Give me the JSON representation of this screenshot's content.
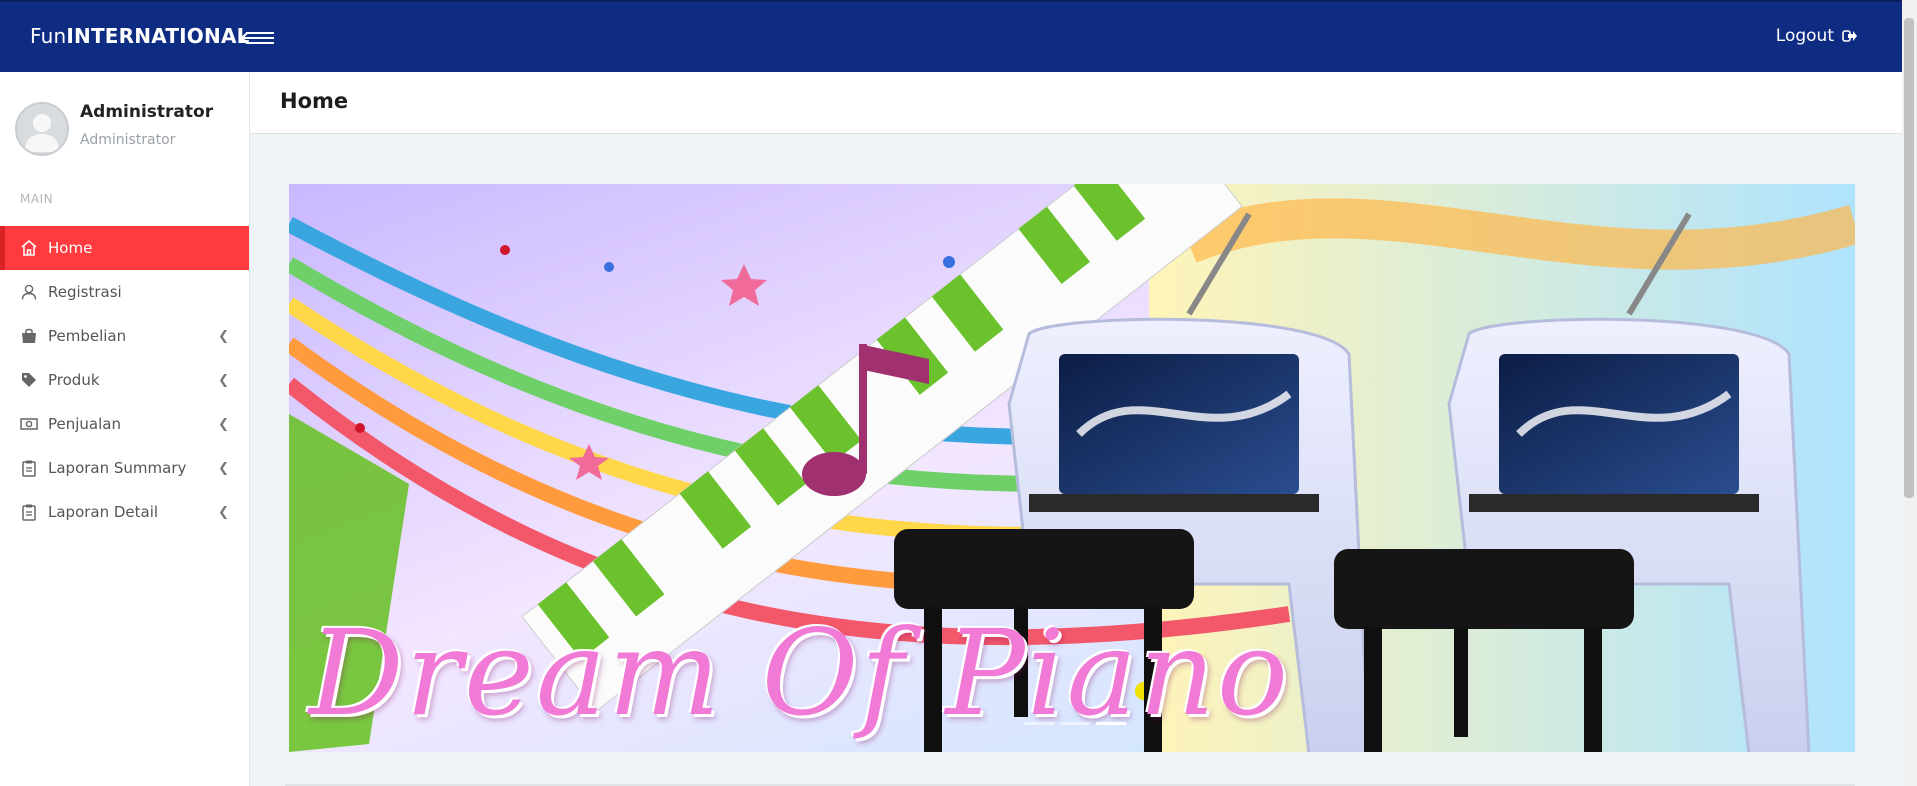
{
  "brand": {
    "part1": "Fun",
    "part2": "INTERNATIONAL"
  },
  "topbar": {
    "logout_label": "Logout",
    "menu_icon": "hamburger-arrow-icon",
    "logout_icon": "sign-out-icon"
  },
  "user": {
    "name": "Administrator",
    "role": "Administrator"
  },
  "sidebar": {
    "section_label": "MAIN",
    "items": [
      {
        "label": "Home",
        "icon": "home-icon",
        "active": true,
        "has_submenu": false
      },
      {
        "label": "Registrasi",
        "icon": "user-icon",
        "active": false,
        "has_submenu": false
      },
      {
        "label": "Pembelian",
        "icon": "shopping-bag-icon",
        "active": false,
        "has_submenu": true
      },
      {
        "label": "Produk",
        "icon": "tag-icon",
        "active": false,
        "has_submenu": true
      },
      {
        "label": "Penjualan",
        "icon": "money-icon",
        "active": false,
        "has_submenu": true
      },
      {
        "label": "Laporan Summary",
        "icon": "clipboard-icon",
        "active": false,
        "has_submenu": true
      },
      {
        "label": "Laporan Detail",
        "icon": "clipboard-icon",
        "active": false,
        "has_submenu": true
      }
    ]
  },
  "page": {
    "title": "Home"
  },
  "banner": {
    "caption": "Dream Of Piano",
    "slides": 3,
    "active_slide": 3
  },
  "colors": {
    "topbar": "#0f2c83",
    "active_nav": "#ff3b3f",
    "content_bg": "#eef3f6"
  }
}
